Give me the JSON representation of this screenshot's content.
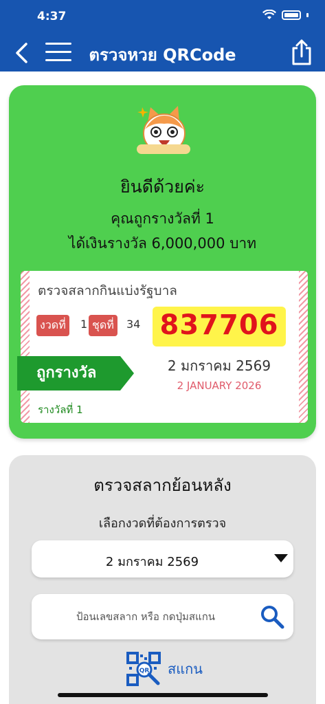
{
  "status_bar": {
    "time": "4:37"
  },
  "nav": {
    "title": "ตรวจหวย QRCode"
  },
  "result": {
    "congrats": "ยินดีด้วยค่ะ",
    "prize_rank": "คุณถูกรางวัลที่ 1",
    "prize_money": "ได้เงินรางวัล 6,000,000 บาท",
    "ticket": {
      "title": "ตรวจสลากกินแบ่งรัฐบาล",
      "draw_label": "งวดที่",
      "draw_value": "1",
      "set_label": "ชุดที่",
      "set_value": "34",
      "number": "837706",
      "date_th": "2 มกราคม 2569",
      "date_en": "2 JANUARY 2026",
      "status": "ถูกรางวัล",
      "prize_note": "รางวัลที่ 1"
    }
  },
  "past": {
    "title": "ตรวจสลากย้อนหลัง",
    "subtitle": "เลือกงวดที่ต้องการตรวจ",
    "selected_date": "2 มกราคม 2569",
    "search_placeholder": "ป้อนเลขสลาก หรือ กดปุ่มสแกน",
    "scan_label": "สแกน"
  },
  "colors": {
    "nav_bg": "#1755b0",
    "card_green": "#4fcf4f",
    "number_red": "#e0141c",
    "number_bg": "#fff44a"
  }
}
